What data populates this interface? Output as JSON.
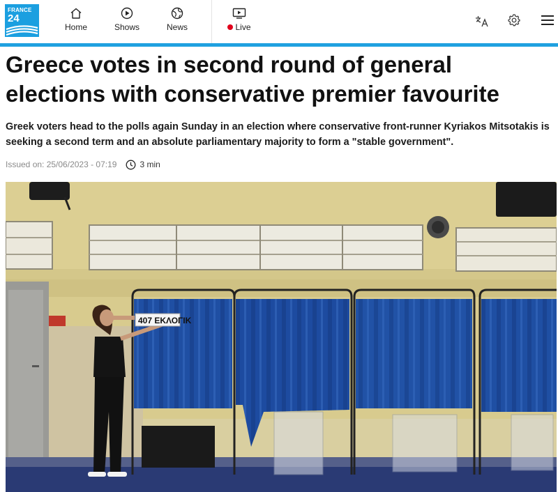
{
  "brand": {
    "logo_line1": "FRANCE",
    "logo_line2": "24",
    "color": "#1b9fe0"
  },
  "nav": {
    "items": [
      {
        "label": "Home",
        "icon": "home-icon"
      },
      {
        "label": "Shows",
        "icon": "play-circle-icon"
      },
      {
        "label": "News",
        "icon": "globe-icon"
      },
      {
        "label": "Live",
        "icon": "tv-icon",
        "status_color": "#e1001c"
      }
    ],
    "right_icons": [
      "language-icon",
      "settings-gear-icon",
      "hamburger-menu-icon"
    ]
  },
  "article": {
    "headline": "Greece votes in second round of general elections with conservative premier favourite",
    "standfirst": "Greek voters head to the polls again Sunday in an election where conservative front-runner Kyriakos Mitsotakis is seeking a second term and an absolute parliamentary majority to form a \"stable government\".",
    "issued": "Issued on: 25/06/2023 - 07:19",
    "read_time": "3 min",
    "photo": {
      "booth_sign": "407 ΕΚΛΟΓΙΚ"
    }
  },
  "colors": {
    "accent": "#1fa1e0",
    "booth_blue": "#1f4fa3"
  }
}
